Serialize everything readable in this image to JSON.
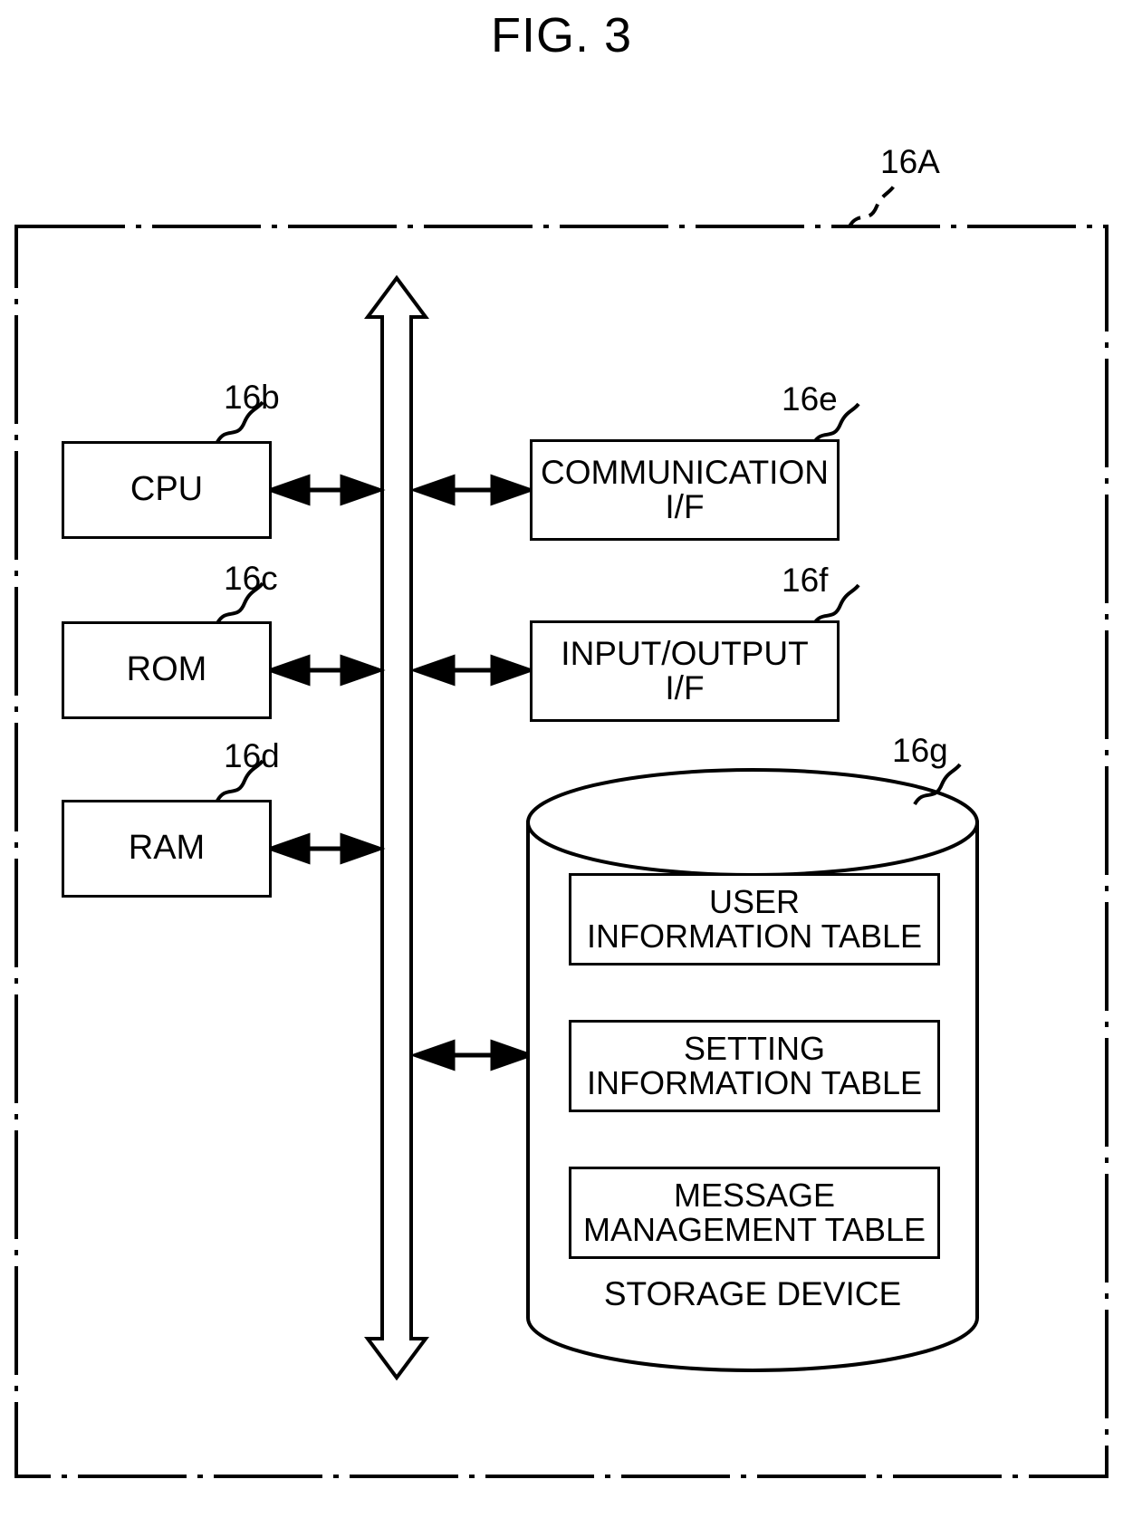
{
  "figure": {
    "title": "FIG. 3"
  },
  "device": {
    "ref": "16A"
  },
  "bus": {
    "name": "bus"
  },
  "components": [
    {
      "label": "CPU",
      "ref": "16b"
    },
    {
      "label": "ROM",
      "ref": "16c"
    },
    {
      "label": "RAM",
      "ref": "16d"
    },
    {
      "label": "COMMUNICATION\nI/F",
      "line1": "COMMUNICATION",
      "line2": "I/F",
      "ref": "16e"
    },
    {
      "label": "INPUT/OUTPUT\nI/F",
      "line1": "INPUT/OUTPUT",
      "line2": "I/F",
      "ref": "16f"
    }
  ],
  "storage": {
    "ref": "16g",
    "label": "STORAGE DEVICE",
    "tables": [
      {
        "line1": "USER",
        "line2": "INFORMATION TABLE"
      },
      {
        "line1": "SETTING",
        "line2": "INFORMATION TABLE"
      },
      {
        "line1": "MESSAGE",
        "line2": "MANAGEMENT TABLE"
      }
    ]
  },
  "colors": {
    "stroke": "#000000",
    "background": "#ffffff"
  }
}
